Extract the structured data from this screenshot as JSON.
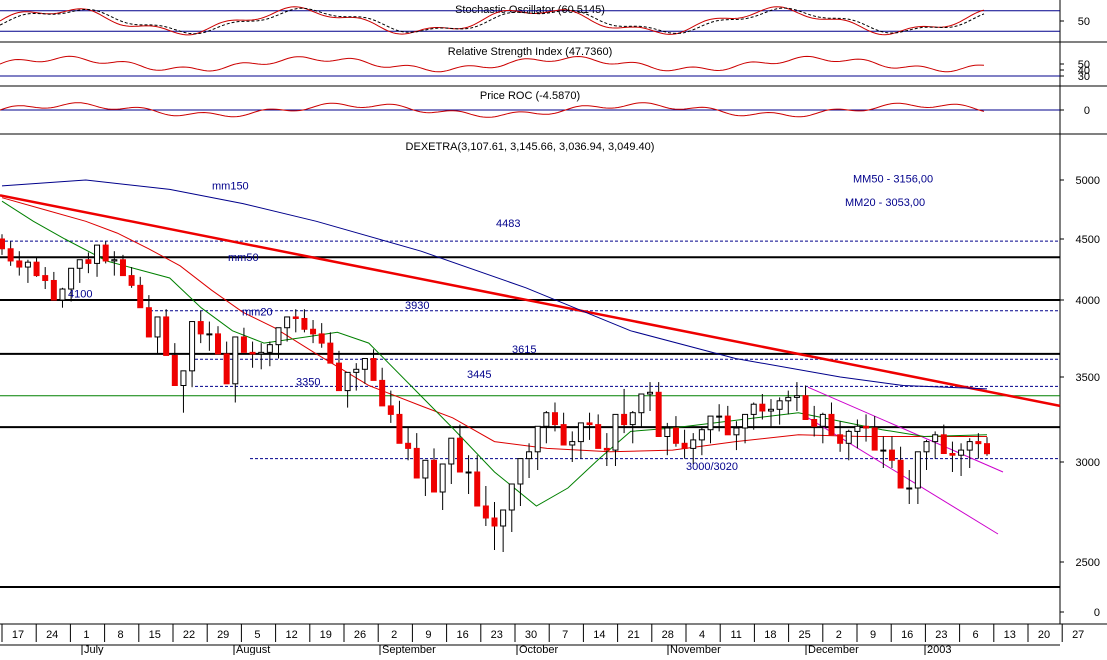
{
  "chart_data": {
    "type": "candlestick",
    "title": "DEXETRA(3,107.61, 3,145.66, 3,036.94, 3,049.40)",
    "ylim": [
      2350,
      5300
    ],
    "yticks": [
      "5000",
      "4500",
      "4000",
      "3500",
      "3000",
      "2500",
      "0"
    ],
    "ytick_values": [
      5000,
      4500,
      4000,
      3500,
      3000,
      2500,
      2340
    ],
    "x_day_ticks": [
      "17",
      "24",
      "1",
      "8",
      "15",
      "22",
      "29",
      "5",
      "12",
      "19",
      "26",
      "2",
      "9",
      "16",
      "23",
      "30",
      "7",
      "14",
      "21",
      "28",
      "4",
      "11",
      "18",
      "25",
      "2",
      "9",
      "16",
      "23",
      "6",
      "13",
      "20",
      "27"
    ],
    "x_month_labels": [
      "July",
      "August",
      "September",
      "October",
      "November",
      "December",
      "2003"
    ],
    "ohlc": {
      "open": [
        4500,
        4420,
        4320,
        4270,
        4310,
        4200,
        4160,
        4000,
        4090,
        4260,
        4330,
        4300,
        4450,
        4320,
        4330,
        4200,
        4120,
        3950,
        3760,
        3890,
        3640,
        3450,
        3540,
        3860,
        3780,
        3780,
        3650,
        3460,
        3760,
        3660,
        3650,
        3660,
        3710,
        3820,
        3890,
        3880,
        3810,
        3780,
        3720,
        3590,
        3420,
        3530,
        3550,
        3620,
        3480,
        3330,
        3280,
        3110,
        3080,
        2920,
        3010,
        2850,
        2990,
        3140,
        2950,
        2950,
        2780,
        2720,
        2680,
        2760,
        2890,
        3020,
        3060,
        3210,
        3290,
        3220,
        3100,
        3120,
        3230,
        3220,
        3080,
        3070,
        3280,
        3220,
        3290,
        3400,
        3410,
        3150,
        3200,
        3110,
        3080,
        3130,
        3190,
        3270,
        3270,
        3160,
        3200,
        3280,
        3340,
        3300,
        3310,
        3360,
        3380,
        3390,
        3250,
        3210,
        3280,
        3160,
        3110,
        3180,
        3210,
        3200,
        3070,
        3070,
        3010,
        2870,
        2870,
        3060,
        3120,
        3160,
        3050,
        3040,
        3070,
        3120,
        3108
      ],
      "high": [
        4540,
        4480,
        4400,
        4330,
        4350,
        4270,
        4230,
        4100,
        4160,
        4320,
        4390,
        4350,
        4480,
        4400,
        4370,
        4270,
        4190,
        4040,
        3850,
        3940,
        3720,
        3540,
        3620,
        3930,
        3860,
        3830,
        3730,
        3550,
        3820,
        3730,
        3720,
        3730,
        3790,
        3880,
        3940,
        3940,
        3870,
        3850,
        3790,
        3670,
        3510,
        3590,
        3620,
        3680,
        3560,
        3420,
        3360,
        3200,
        3170,
        3010,
        3080,
        2930,
        3080,
        3220,
        3040,
        3040,
        2880,
        2800,
        2760,
        2830,
        2980,
        3110,
        3150,
        3300,
        3350,
        3290,
        3180,
        3190,
        3290,
        3280,
        3170,
        3160,
        3430,
        3300,
        3360,
        3470,
        3470,
        3230,
        3270,
        3190,
        3170,
        3210,
        3260,
        3340,
        3330,
        3240,
        3280,
        3350,
        3400,
        3370,
        3380,
        3420,
        3470,
        3450,
        3330,
        3290,
        3350,
        3240,
        3190,
        3250,
        3280,
        3270,
        3150,
        3150,
        3090,
        2960,
        2960,
        3130,
        3180,
        3220,
        3120,
        3110,
        3140,
        3170,
        3146
      ],
      "low": [
        4370,
        4280,
        4200,
        4140,
        4190,
        4090,
        4040,
        3950,
        3990,
        4140,
        4220,
        4190,
        4300,
        4200,
        4220,
        4100,
        4000,
        3840,
        3650,
        3760,
        3540,
        3290,
        3440,
        3720,
        3670,
        3680,
        3540,
        3350,
        3660,
        3560,
        3550,
        3570,
        3620,
        3730,
        3790,
        3790,
        3720,
        3690,
        3610,
        3480,
        3320,
        3420,
        3460,
        3520,
        3380,
        3230,
        3170,
        3010,
        2970,
        2830,
        2900,
        2760,
        2890,
        3040,
        2840,
        2840,
        2680,
        2560,
        2550,
        2650,
        2780,
        2920,
        2960,
        3110,
        3180,
        3110,
        3000,
        3020,
        3130,
        3130,
        2980,
        2980,
        3170,
        3110,
        3200,
        3300,
        3310,
        3040,
        3090,
        3020,
        2990,
        3040,
        3110,
        3180,
        3190,
        3070,
        3110,
        3190,
        3250,
        3210,
        3220,
        3280,
        3300,
        3310,
        3150,
        3110,
        3180,
        3060,
        3010,
        3080,
        3120,
        3110,
        2970,
        2970,
        2900,
        2790,
        2790,
        2960,
        3020,
        3060,
        2950,
        2930,
        2970,
        3020,
        3037
      ],
      "close": [
        4420,
        4320,
        4270,
        4310,
        4200,
        4160,
        4000,
        4090,
        4260,
        4330,
        4300,
        4450,
        4320,
        4330,
        4200,
        4120,
        3950,
        3760,
        3890,
        3640,
        3450,
        3540,
        3860,
        3780,
        3780,
        3650,
        3460,
        3760,
        3660,
        3650,
        3660,
        3710,
        3820,
        3890,
        3880,
        3810,
        3780,
        3720,
        3590,
        3420,
        3530,
        3550,
        3620,
        3480,
        3330,
        3280,
        3110,
        3080,
        2920,
        3010,
        2850,
        2990,
        3140,
        2950,
        2950,
        2780,
        2720,
        2680,
        2760,
        2890,
        3020,
        3060,
        3210,
        3290,
        3220,
        3100,
        3120,
        3230,
        3220,
        3080,
        3070,
        3280,
        3220,
        3290,
        3400,
        3410,
        3150,
        3200,
        3110,
        3080,
        3130,
        3190,
        3270,
        3270,
        3160,
        3200,
        3280,
        3340,
        3300,
        3310,
        3360,
        3380,
        3390,
        3250,
        3210,
        3280,
        3160,
        3110,
        3180,
        3210,
        3200,
        3070,
        3070,
        3010,
        2870,
        2870,
        3060,
        3120,
        3160,
        3050,
        3040,
        3070,
        3120,
        3108,
        3049
      ]
    },
    "moving_averages": [
      {
        "name": "mm150",
        "color": "#00008b",
        "points": [
          [
            0,
            5050
          ],
          [
            40,
            5000
          ],
          [
            80,
            4920
          ],
          [
            115,
            4800
          ],
          [
            150,
            4650
          ],
          [
            200,
            4400
          ],
          [
            250,
            4100
          ],
          [
            300,
            3800
          ],
          [
            350,
            3620
          ],
          [
            400,
            3500
          ],
          [
            430,
            3450
          ],
          [
            470,
            3430
          ]
        ]
      },
      {
        "name": "mm50",
        "color": "#dd0000",
        "points": [
          [
            0,
            4850
          ],
          [
            20,
            4750
          ],
          [
            40,
            4650
          ],
          [
            55,
            4550
          ],
          [
            70,
            4420
          ],
          [
            85,
            4280
          ],
          [
            100,
            4080
          ],
          [
            115,
            3920
          ],
          [
            130,
            3820
          ],
          [
            150,
            3650
          ],
          [
            175,
            3450
          ],
          [
            200,
            3330
          ],
          [
            215,
            3260
          ],
          [
            235,
            3120
          ],
          [
            260,
            3080
          ],
          [
            290,
            3060
          ],
          [
            320,
            3070
          ],
          [
            350,
            3120
          ],
          [
            380,
            3160
          ],
          [
            410,
            3150
          ],
          [
            440,
            3150
          ],
          [
            470,
            3150
          ]
        ]
      },
      {
        "name": "mm20",
        "color": "#008000",
        "points": [
          [
            0,
            4820
          ],
          [
            15,
            4650
          ],
          [
            30,
            4500
          ],
          [
            50,
            4320
          ],
          [
            65,
            4250
          ],
          [
            80,
            4180
          ],
          [
            95,
            3950
          ],
          [
            110,
            3800
          ],
          [
            125,
            3720
          ],
          [
            145,
            3760
          ],
          [
            160,
            3790
          ],
          [
            175,
            3720
          ],
          [
            195,
            3450
          ],
          [
            215,
            3200
          ],
          [
            235,
            2950
          ],
          [
            255,
            2780
          ],
          [
            270,
            2870
          ],
          [
            285,
            3020
          ],
          [
            300,
            3180
          ],
          [
            320,
            3200
          ],
          [
            340,
            3230
          ],
          [
            360,
            3260
          ],
          [
            380,
            3290
          ],
          [
            400,
            3240
          ],
          [
            420,
            3190
          ],
          [
            440,
            3150
          ],
          [
            470,
            3160
          ]
        ]
      }
    ],
    "horizontal_lines": [
      {
        "value": 4350,
        "style": "solid"
      },
      {
        "value": 4000,
        "style": "solid"
      },
      {
        "value": 3650,
        "style": "solid"
      },
      {
        "value": 3205,
        "style": "solid"
      },
      {
        "value": 2420,
        "style": "solid"
      }
    ],
    "green_line": 3390,
    "dashed_levels": [
      {
        "label": "4483",
        "value": 4483,
        "x_start": 0
      },
      {
        "label": "3930",
        "value": 3930,
        "x_start": 150
      },
      {
        "label": "3615",
        "value": 3615,
        "x_start": 195
      },
      {
        "label": "3445",
        "value": 3445,
        "x_start": 195
      },
      {
        "label": "3000/3020",
        "value": 3020,
        "x_start": 250
      }
    ],
    "trend_lines": [
      {
        "name": "red-trend",
        "color": "#ee0000",
        "points": [
          [
            0,
            4870
          ],
          [
            1060,
            3330
          ]
        ]
      },
      {
        "name": "magenta-upper",
        "color": "#cc00cc",
        "points": [
          [
            808,
            3440
          ],
          [
            1003,
            2950
          ]
        ]
      },
      {
        "name": "magenta-lower",
        "color": "#cc00cc",
        "points": [
          [
            808,
            3260
          ],
          [
            998,
            2640
          ]
        ]
      }
    ],
    "annotations": [
      {
        "text": "mm150",
        "value": 4920,
        "x": 212
      },
      {
        "text": "mm50",
        "value": 4320,
        "x": 228
      },
      {
        "text": "mm20",
        "value": 3900,
        "x": 242
      },
      {
        "text": "4100",
        "value": 4020,
        "x": 68
      },
      {
        "text": "3350",
        "value": 3450,
        "x": 296
      },
      {
        "text": "MM20 - 3053,00",
        "value": 5220,
        "x": 845
      },
      {
        "text": "MM50 - 3156,00",
        "value": 4980,
        "x": 853
      }
    ],
    "indicators": [
      {
        "title": "Stochastic Oscillator (60.5145)",
        "yticks": [
          "50"
        ],
        "levels": [
          80,
          20
        ]
      },
      {
        "title": "Relative Strength Index (47.7360)",
        "yticks": [
          "50",
          "40",
          "30"
        ],
        "levels": [
          70,
          30
        ]
      },
      {
        "title": "Price ROC (-4.5870)",
        "yticks": [
          "0"
        ],
        "levels": [
          0
        ]
      }
    ]
  }
}
